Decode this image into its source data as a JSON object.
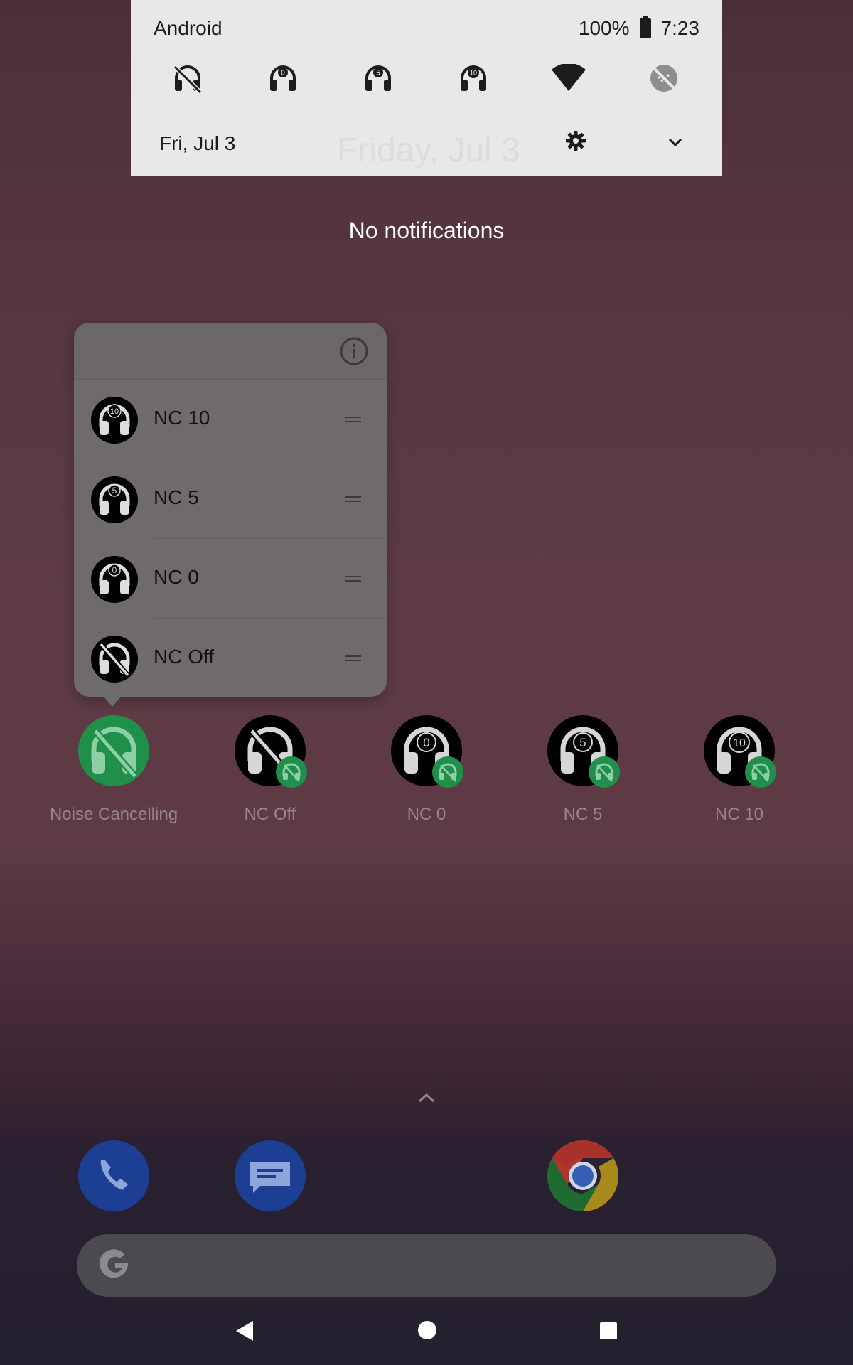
{
  "status": {
    "carrier": "Android",
    "battery": "100%",
    "time": "7:23"
  },
  "quick_settings": {
    "tiles": [
      {
        "icon": "nc-off-headphones-icon"
      },
      {
        "icon": "nc-0-headphones-icon",
        "badge": "0"
      },
      {
        "icon": "nc-5-headphones-icon",
        "badge": "5"
      },
      {
        "icon": "nc-10-headphones-icon",
        "badge": "10"
      },
      {
        "icon": "wifi-icon"
      },
      {
        "icon": "data-saver-off-icon"
      }
    ],
    "date": "Fri, Jul 3",
    "ghost_date": "Friday, Jul 3"
  },
  "notifications": {
    "empty_text": "No notifications"
  },
  "popup": {
    "items": [
      {
        "label": "NC 10",
        "badge": "10"
      },
      {
        "label": "NC 5",
        "badge": "5"
      },
      {
        "label": "NC 0",
        "badge": "0"
      },
      {
        "label": "NC Off",
        "badge": ""
      }
    ]
  },
  "home": {
    "shortcuts": [
      {
        "label": "Noise Cancelling",
        "badge": ""
      },
      {
        "label": "NC Off",
        "badge": ""
      },
      {
        "label": "NC 0",
        "badge": "0"
      },
      {
        "label": "NC 5",
        "badge": "5"
      },
      {
        "label": "NC 10",
        "badge": "10"
      }
    ]
  },
  "dock": {
    "apps": [
      {
        "icon": "phone-icon"
      },
      {
        "icon": "messages-icon"
      },
      {
        "icon": "chrome-icon"
      }
    ],
    "search_icon": "google-g-icon"
  },
  "colors": {
    "accent_green": "#1f8f4a",
    "panel": "#e9e7e8",
    "popup": "#6e6a6e"
  }
}
